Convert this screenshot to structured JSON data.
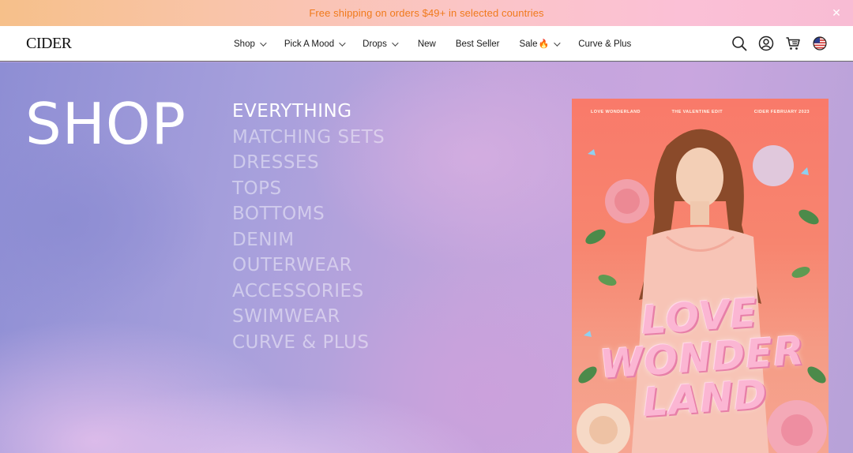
{
  "promo": {
    "text": "Free shipping on orders $49+ in selected countries",
    "close_icon": "close-icon"
  },
  "header": {
    "logo": "CIDER",
    "nav": [
      {
        "label": "Shop",
        "dropdown": true
      },
      {
        "label": "Pick A Mood",
        "dropdown": true
      },
      {
        "label": "Drops",
        "dropdown": true
      },
      {
        "label": "New",
        "dropdown": false
      },
      {
        "label": "Best Seller",
        "dropdown": false
      },
      {
        "label": "Sale",
        "dropdown": true,
        "badge_icon": "fire-icon"
      },
      {
        "label": "Curve & Plus",
        "dropdown": false
      }
    ],
    "icons": [
      "search-icon",
      "account-icon",
      "cart-icon",
      "us-flag-icon"
    ]
  },
  "hero": {
    "title": "SHOP",
    "categories": [
      {
        "label": "EVERYTHING",
        "active": true
      },
      {
        "label": "MATCHING SETS",
        "active": false
      },
      {
        "label": "DRESSES",
        "active": false
      },
      {
        "label": "TOPS",
        "active": false
      },
      {
        "label": "BOTTOMS",
        "active": false
      },
      {
        "label": "DENIM",
        "active": false
      },
      {
        "label": "OUTERWEAR",
        "active": false
      },
      {
        "label": "ACCESSORIES",
        "active": false
      },
      {
        "label": "SWIMWEAR",
        "active": false
      },
      {
        "label": "CURVE & PLUS",
        "active": false
      }
    ],
    "poster": {
      "top_left": "LOVE WONDERLAND",
      "top_center": "THE VALENTINE EDIT",
      "top_right": "CIDER FEBRUARY 2023",
      "headline_lines": [
        "LOVE",
        "WONDER",
        "LAND"
      ]
    }
  },
  "colors": {
    "promo_text": "#f07a1c",
    "poster_bg": "#f97a6a",
    "headline_pink": "#fbb6d3"
  }
}
